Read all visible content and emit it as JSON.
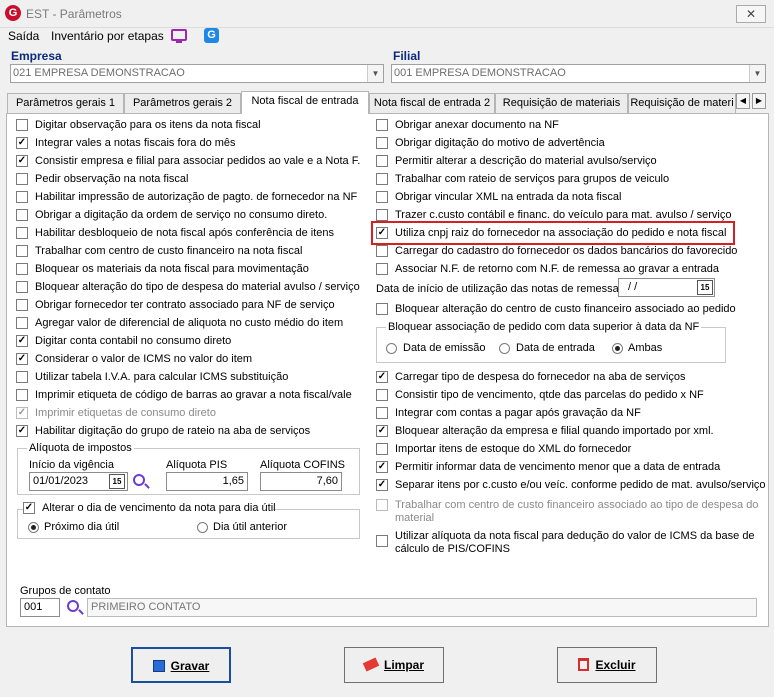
{
  "window": {
    "title": "EST - Parâmetros",
    "logo": "G",
    "close": "✕"
  },
  "menu": {
    "items": [
      "Saída",
      "Inventário por etapas"
    ]
  },
  "empresa": {
    "label": "Empresa",
    "value": "021 EMPRESA DEMONSTRACAO"
  },
  "filial": {
    "label": "Filial",
    "value": "001 EMPRESA DEMONSTRACAO"
  },
  "tabs": [
    "Parâmetros gerais 1",
    "Parâmetros gerais 2",
    "Nota fiscal de entrada",
    "Nota fiscal de entrada 2",
    "Requisição de materiais",
    "Requisição de materi"
  ],
  "left_checks": [
    {
      "label": "Digitar observação para os itens da nota fiscal",
      "checked": false
    },
    {
      "label": "Integrar vales a notas fiscais fora do mês",
      "checked": true
    },
    {
      "label": "Consistir empresa e filial para associar pedidos ao vale e a Nota F.",
      "checked": true
    },
    {
      "label": "Pedir observação na nota fiscal",
      "checked": false
    },
    {
      "label": "Habilitar impressão de autorização de pagto. de fornecedor na NF",
      "checked": false
    },
    {
      "label": "Obrigar a digitação da ordem de serviço no consumo direto.",
      "checked": false
    },
    {
      "label": "Habilitar desbloqueio de nota fiscal após conferência de itens",
      "checked": false
    },
    {
      "label": "Trabalhar com centro de custo financeiro na nota fiscal",
      "checked": false
    },
    {
      "label": "Bloquear os materiais da nota fiscal para movimentação",
      "checked": false
    },
    {
      "label": "Bloquear alteração do tipo de despesa do material avulso / serviço",
      "checked": false
    },
    {
      "label": "Obrigar fornecedor ter contrato associado para NF de serviço",
      "checked": false
    },
    {
      "label": "Agregar valor de diferencial de aliquota no custo médio do item",
      "checked": false
    },
    {
      "label": "Digitar conta contabil no consumo direto",
      "checked": true
    },
    {
      "label": "Considerar o valor de ICMS no valor do item",
      "checked": true
    },
    {
      "label": "Utilizar tabela I.V.A. para calcular ICMS substituição",
      "checked": false
    },
    {
      "label": "Imprimir etiqueta de código de barras ao gravar a nota fiscal/vale",
      "checked": false
    },
    {
      "label": "Imprimir etiquetas de consumo direto",
      "checked": true,
      "disabled": true
    },
    {
      "label": "Habilitar digitação do grupo de rateio na aba de serviços",
      "checked": true
    }
  ],
  "aliquota": {
    "title": "Alíquota de impostos",
    "inicio_label": "Início da vigência",
    "inicio_value": "01/01/2023",
    "pis_label": "Alíquota PIS",
    "pis_value": "1,65",
    "cofins_label": "Alíquota COFINS",
    "cofins_value": "7,60"
  },
  "vencimento": {
    "title": "Alterar o dia de vencimento da nota para dia útil",
    "opt1": "Próximo dia útil",
    "opt2": "Dia útil anterior"
  },
  "right_checks_a": [
    {
      "label": "Obrigar anexar documento na NF",
      "checked": false
    },
    {
      "label": "Obrigar digitação do motivo de advertência",
      "checked": false
    },
    {
      "label": "Permitir alterar a descrição do material avulso/serviço",
      "checked": false
    },
    {
      "label": "Trabalhar com rateio de serviços para grupos de veiculo",
      "checked": false
    },
    {
      "label": "Obrigar vincular XML na entrada da nota fiscal",
      "checked": false
    },
    {
      "label": "Trazer c.custo contábil e financ. do veículo para mat. avulso / serviço",
      "checked": false
    },
    {
      "label": "Utiliza cnpj raiz do fornecedor na associação do pedido e nota fiscal",
      "checked": true
    },
    {
      "label": "Carregar do cadastro do fornecedor os dados bancários do favorecido",
      "checked": false
    },
    {
      "label": "Associar N.F. de retorno com N.F. de remessa ao gravar a entrada",
      "checked": false
    }
  ],
  "data_inicio": {
    "label": "Data de início de utilização das notas de remessa",
    "value": "/ /"
  },
  "bloq_centro": {
    "label": "Bloquear alteração do centro de custo financeiro associado ao pedido",
    "checked": false
  },
  "bloq_assoc": {
    "title": "Bloquear associação de pedido com data superior à data da NF",
    "opt1": "Data de emissão",
    "opt2": "Data de entrada",
    "opt3": "Ambas"
  },
  "right_checks_b": [
    {
      "label": "Carregar tipo de despesa do fornecedor na aba de serviços",
      "checked": true
    },
    {
      "label": "Consistir tipo de vencimento, qtde das parcelas do pedido x NF",
      "checked": false
    },
    {
      "label": "Integrar com contas a pagar após gravação da NF",
      "checked": false
    },
    {
      "label": "Bloquear alteração da empresa e filial quando importado por xml.",
      "checked": true
    },
    {
      "label": "Importar itens de estoque do XML do fornecedor",
      "checked": false
    },
    {
      "label": "Permitir informar data de vencimento menor que a data de entrada",
      "checked": true
    },
    {
      "label": "Separar itens por c.custo e/ou veíc. conforme pedido de mat. avulso/serviço",
      "checked": true
    }
  ],
  "trab_centro": {
    "line1": "Trabalhar com centro de custo financeiro associado ao tipo de despesa do",
    "line2": "material"
  },
  "utilizar_aliq": {
    "line1": "Utilizar alíquota da nota fiscal para dedução do valor de ICMS da base de",
    "line2": "cálculo de PIS/COFINS"
  },
  "grupos": {
    "label": "Grupos de contato",
    "code": "001",
    "name": "PRIMEIRO CONTATO"
  },
  "buttons": {
    "gravar": "Gravar",
    "limpar": "Limpar",
    "excluir": "Excluir"
  },
  "colors": {
    "highlight": "#d42020",
    "header": "#0a2a7a",
    "icon": "#6a3fd0"
  }
}
